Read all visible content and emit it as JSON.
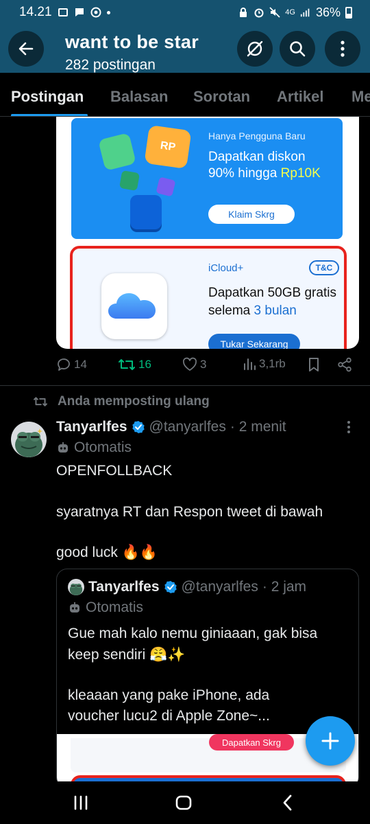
{
  "status_bar": {
    "time": "14.21",
    "network": "4G",
    "battery": "36%"
  },
  "header": {
    "title": "want to be star",
    "subtitle": "282 postingan"
  },
  "tabs": [
    {
      "label": "Postingan",
      "active": true
    },
    {
      "label": "Balasan",
      "active": false
    },
    {
      "label": "Sorotan",
      "active": false
    },
    {
      "label": "Artikel",
      "active": false
    },
    {
      "label": "Me",
      "active": false
    }
  ],
  "post1": {
    "media": {
      "promo1": {
        "small": "Hanya Pengguna Baru",
        "line1": "Dapatkan diskon",
        "line2_prefix": "90% hingga ",
        "line2_highlight": "Rp10K",
        "button": "Klaim Skrg",
        "icon_text": "RP"
      },
      "promo2": {
        "brand": "iCloud+",
        "badge": "T&C",
        "line1": "Dapatkan 50GB gratis",
        "line2_prefix": "selema ",
        "line2_highlight": "3 bulan",
        "button": "Tukar Sekarang"
      }
    },
    "actions": {
      "replies": "14",
      "reposts": "16",
      "likes": "3",
      "views": "3,1rb"
    }
  },
  "post2": {
    "repost_context": "Anda memposting ulang",
    "author": {
      "name": "Tanyarlfes",
      "handle": "@tanyarlfes",
      "time": "· 2 menit"
    },
    "automated_label": "Otomatis",
    "text_lines": [
      "OPENFOLLBACK",
      "syaratnya RT dan Respon tweet di bawah",
      "good luck 🔥🔥"
    ],
    "quote": {
      "author": {
        "name": "Tanyarlfes",
        "handle": "@tanyarlfes",
        "time": "· 2 jam"
      },
      "automated_label": "Otomatis",
      "text_lines": [
        "Gue mah kalo nemu giniaaan, gak bisa",
        "keep sendiri 😤✨",
        "kleaaan yang pake iPhone, ada",
        "voucher lucu2 di Apple Zone~..."
      ],
      "media_button": "Dapatkan Skrg"
    }
  },
  "colors": {
    "header_bg": "#15526f",
    "accent": "#1d9bf0",
    "repost_green": "#00ba7c",
    "muted": "#71767b"
  }
}
